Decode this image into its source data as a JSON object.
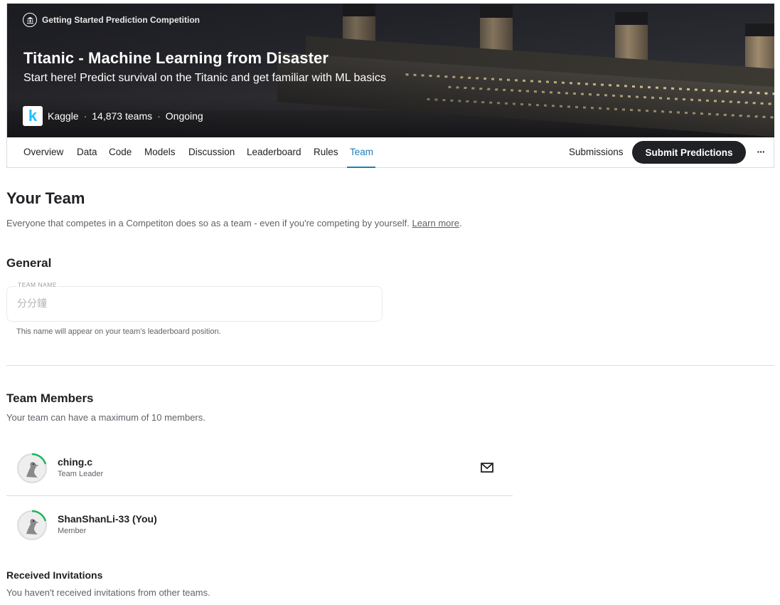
{
  "competition": {
    "category_label": "Getting Started Prediction Competition",
    "title": "Titanic - Machine Learning from Disaster",
    "subtitle": "Start here! Predict survival on the Titanic and get familiar with ML basics",
    "host": "Kaggle",
    "teams": "14,873 teams",
    "status": "Ongoing",
    "host_logo_letter": "k"
  },
  "tabs": [
    {
      "label": "Overview",
      "active": false
    },
    {
      "label": "Data",
      "active": false
    },
    {
      "label": "Code",
      "active": false
    },
    {
      "label": "Models",
      "active": false
    },
    {
      "label": "Discussion",
      "active": false
    },
    {
      "label": "Leaderboard",
      "active": false
    },
    {
      "label": "Rules",
      "active": false
    },
    {
      "label": "Team",
      "active": true
    }
  ],
  "toolbar": {
    "submissions_label": "Submissions",
    "submit_label": "Submit Predictions",
    "more_label": "···"
  },
  "page": {
    "title": "Your Team",
    "intro_text": "Everyone that competes in a Competiton does so as a team - even if you're competing by yourself.",
    "learn_more": "Learn more"
  },
  "general": {
    "heading": "General",
    "team_name_label": "TEAM NAME",
    "team_name_value": "分分鐘",
    "team_name_help": "This name will appear on your team's leaderboard position."
  },
  "members": {
    "heading": "Team Members",
    "subtext": "Your team can have a maximum of 10 members.",
    "list": [
      {
        "name": "ching.c",
        "role": "Team Leader",
        "icon": "mail-icon"
      },
      {
        "name": "ShanShanLi-33 (You)",
        "role": "Member"
      }
    ]
  },
  "invitations": {
    "heading": "Received Invitations",
    "subtext": "You haven't received invitations from other teams."
  },
  "colors": {
    "accent": "#1c7fb5",
    "kaggle_blue": "#20beff",
    "progress_green": "#1fb45a",
    "dark_button": "#202124"
  }
}
